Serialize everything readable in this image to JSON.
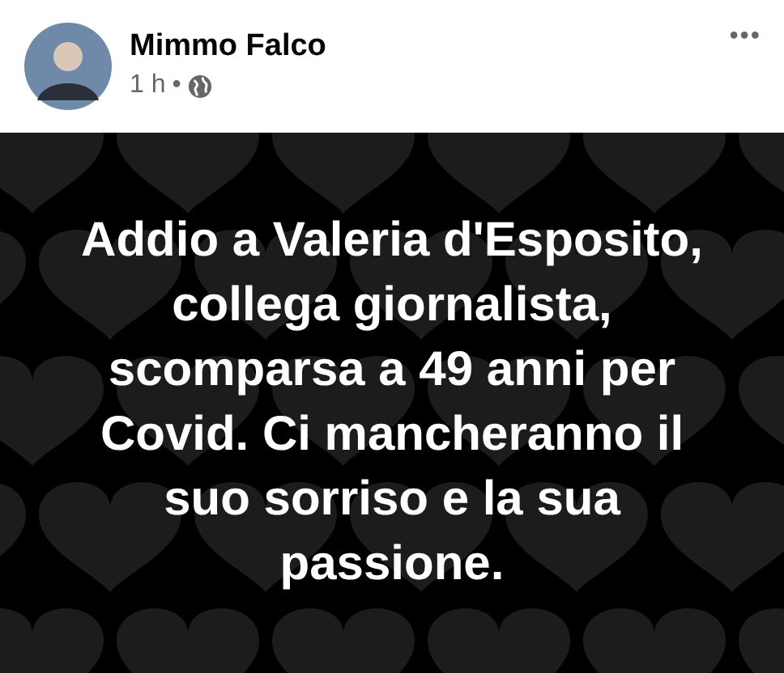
{
  "post": {
    "author": "Mimmo Falco",
    "time": "1 h",
    "separator": "•",
    "menu": "•••"
  },
  "content": {
    "text": "Addio a Valeria d'Esposito, collega giornalista, scomparsa a 49 anni per Covid. Ci mancheranno il suo sorriso e la sua passione."
  }
}
